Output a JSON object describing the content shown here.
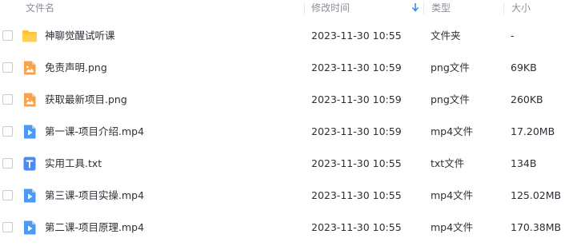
{
  "header": {
    "name_label": "文件名",
    "time_label": "修改时间",
    "sort_icon": "arrow-down-icon",
    "type_label": "类型",
    "size_label": "大小"
  },
  "colors": {
    "folder": "#ffc12e",
    "image": "#f9a24a",
    "video": "#4a9bf5",
    "text_doc": "#4a8af4",
    "sort_accent": "#3a8ee6"
  },
  "files": [
    {
      "name": "神聊觉醒试听课",
      "modified": "2023-11-30 10:55",
      "type": "文件夹",
      "size": "-",
      "icon": "folder-icon"
    },
    {
      "name": "免责声明.png",
      "modified": "2023-11-30 10:59",
      "type": "png文件",
      "size": "69KB",
      "icon": "image-file-icon"
    },
    {
      "name": "获取最新项目.png",
      "modified": "2023-11-30 10:59",
      "type": "png文件",
      "size": "260KB",
      "icon": "image-file-icon"
    },
    {
      "name": "第一课-项目介绍.mp4",
      "modified": "2023-11-30 10:59",
      "type": "mp4文件",
      "size": "17.20MB",
      "icon": "video-file-icon"
    },
    {
      "name": "实用工具.txt",
      "modified": "2023-11-30 10:55",
      "type": "txt文件",
      "size": "134B",
      "icon": "text-file-icon"
    },
    {
      "name": "第三课-项目实操.mp4",
      "modified": "2023-11-30 10:55",
      "type": "mp4文件",
      "size": "125.02MB",
      "icon": "video-file-icon"
    },
    {
      "name": "第二课-项目原理.mp4",
      "modified": "2023-11-30 10:55",
      "type": "mp4文件",
      "size": "170.38MB",
      "icon": "video-file-icon"
    }
  ]
}
